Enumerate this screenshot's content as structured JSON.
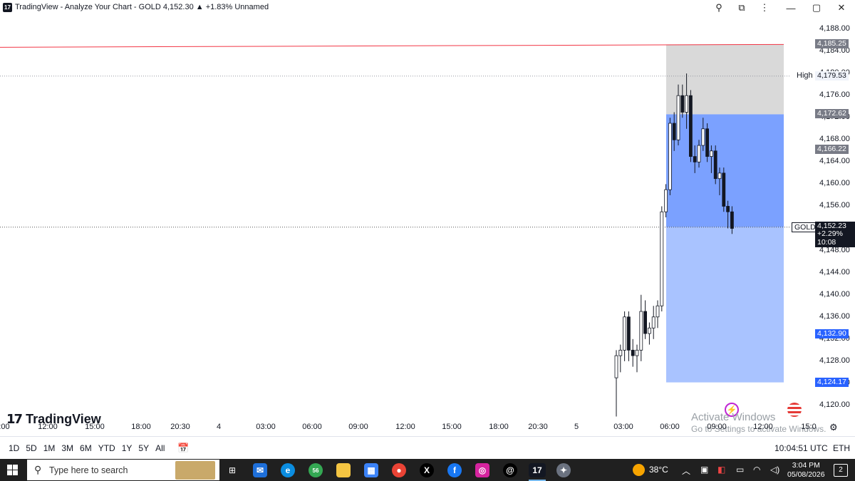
{
  "window": {
    "title": "TradingView - Analyze Your Chart - GOLD 4,152.30 ▲ +1.83% Unnamed",
    "controls": [
      "zoom-icon",
      "extension-icon",
      "more-icon",
      "minimize-icon",
      "restore-icon",
      "close-icon"
    ]
  },
  "chart": {
    "symbol": "GOLD",
    "watermark": "TradingView",
    "price_axis_labels": [
      "4,188.00",
      "4,184.00",
      "4,180.00",
      "4,176.00",
      "4,172.00",
      "4,168.00",
      "4,164.00",
      "4,160.00",
      "4,156.00",
      "4,152.00",
      "4,148.00",
      "4,144.00",
      "4,140.00",
      "4,136.00",
      "4,132.00",
      "4,128.00",
      "4,124.00",
      "4,120.00"
    ],
    "price_axis_values": [
      4188,
      4184,
      4180,
      4176,
      4172,
      4168,
      4164,
      4160,
      4156,
      4152,
      4148,
      4144,
      4140,
      4136,
      4132,
      4128,
      4124,
      4120
    ],
    "high_label": "High",
    "high_value": "4,179.53",
    "red_line_value": "4,185.25",
    "stop_zone_top": "4,185.25",
    "entry_value": "4,172.62",
    "mid_value": "4,166.22",
    "current": {
      "symbol": "GOLD",
      "price": "4,152.23",
      "change": "+2.29%",
      "countdown": "10:08"
    },
    "target_value": "4,132.90",
    "target2_value": "4,124.17",
    "colors": {
      "stop_zone": "#d9d9d9",
      "profit_dark": "#7ba1ff",
      "profit_light": "#a9c3ff",
      "red_line": "#f23645",
      "label_blue": "#2962ff",
      "label_gray": "#787b86"
    },
    "time_labels": [
      ":00",
      "12:00",
      "15:00",
      "18:00",
      "20:30",
      "4",
      "03:00",
      "06:00",
      "09:00",
      "12:00",
      "15:00",
      "18:00",
      "20:30",
      "5",
      "03:00",
      "06:00",
      "09:00",
      "12:00",
      "15:0"
    ]
  },
  "activate": {
    "line1": "Activate Windows",
    "line2": "Go to Settings to activate Windows."
  },
  "bottombar": {
    "ranges": [
      "1D",
      "5D",
      "1M",
      "3M",
      "6M",
      "YTD",
      "1Y",
      "5Y",
      "All"
    ],
    "clock": "10:04:51 UTC",
    "session": "ETH"
  },
  "taskbar": {
    "search_placeholder": "Type here to search",
    "apps": [
      "task-view-icon",
      "mail-icon",
      "edge-icon",
      "chrome-badge-icon",
      "file-explorer-icon",
      "store-icon",
      "chrome-icon",
      "x-icon",
      "facebook-icon",
      "instagram-icon",
      "threads-icon",
      "tradingview-icon",
      "app-icon"
    ],
    "chrome_badge": "56",
    "temperature": "38°C",
    "time": "3:04 PM",
    "date": "05/08/2026",
    "notifications": "2"
  },
  "chart_data": {
    "type": "candlestick",
    "symbol": "GOLD",
    "ylim": [
      4118,
      4190
    ],
    "levels": {
      "high": 4179.53,
      "resistance": 4185.25,
      "entry": 4172.62,
      "mid": 4166.22,
      "current": 4152.23,
      "target1": 4132.9,
      "target2": 4124.17
    },
    "candles": [
      {
        "o": 4125,
        "h": 4130,
        "l": 4118,
        "c": 4129
      },
      {
        "o": 4129,
        "h": 4131,
        "l": 4126,
        "c": 4130
      },
      {
        "o": 4130,
        "h": 4137,
        "l": 4128,
        "c": 4136
      },
      {
        "o": 4136,
        "h": 4137,
        "l": 4128,
        "c": 4130
      },
      {
        "o": 4130,
        "h": 4132,
        "l": 4127,
        "c": 4129
      },
      {
        "o": 4129,
        "h": 4131,
        "l": 4126,
        "c": 4130
      },
      {
        "o": 4130,
        "h": 4140,
        "l": 4128,
        "c": 4137
      },
      {
        "o": 4137,
        "h": 4139,
        "l": 4132,
        "c": 4133
      },
      {
        "o": 4133,
        "h": 4135,
        "l": 4131,
        "c": 4134
      },
      {
        "o": 4134,
        "h": 4138,
        "l": 4132,
        "c": 4136
      },
      {
        "o": 4136,
        "h": 4139,
        "l": 4134,
        "c": 4138
      },
      {
        "o": 4138,
        "h": 4156,
        "l": 4137,
        "c": 4155
      },
      {
        "o": 4155,
        "h": 4160,
        "l": 4154,
        "c": 4159
      },
      {
        "o": 4159,
        "h": 4172,
        "l": 4158,
        "c": 4171
      },
      {
        "o": 4171,
        "h": 4173,
        "l": 4166,
        "c": 4168
      },
      {
        "o": 4168,
        "h": 4178,
        "l": 4167,
        "c": 4176
      },
      {
        "o": 4176,
        "h": 4178,
        "l": 4172,
        "c": 4173
      },
      {
        "o": 4173,
        "h": 4180,
        "l": 4170,
        "c": 4176
      },
      {
        "o": 4176,
        "h": 4177,
        "l": 4164,
        "c": 4165
      },
      {
        "o": 4165,
        "h": 4167,
        "l": 4162,
        "c": 4164
      },
      {
        "o": 4164,
        "h": 4168,
        "l": 4163,
        "c": 4167
      },
      {
        "o": 4167,
        "h": 4172,
        "l": 4166,
        "c": 4170
      },
      {
        "o": 4170,
        "h": 4171,
        "l": 4164,
        "c": 4165
      },
      {
        "o": 4165,
        "h": 4167,
        "l": 4162,
        "c": 4166
      },
      {
        "o": 4166,
        "h": 4167,
        "l": 4160,
        "c": 4161
      },
      {
        "o": 4161,
        "h": 4163,
        "l": 4158,
        "c": 4162
      },
      {
        "o": 4162,
        "h": 4163,
        "l": 4155,
        "c": 4156
      },
      {
        "o": 4156,
        "h": 4157,
        "l": 4152,
        "c": 4155
      },
      {
        "o": 4155,
        "h": 4156,
        "l": 4151,
        "c": 4152
      }
    ]
  }
}
